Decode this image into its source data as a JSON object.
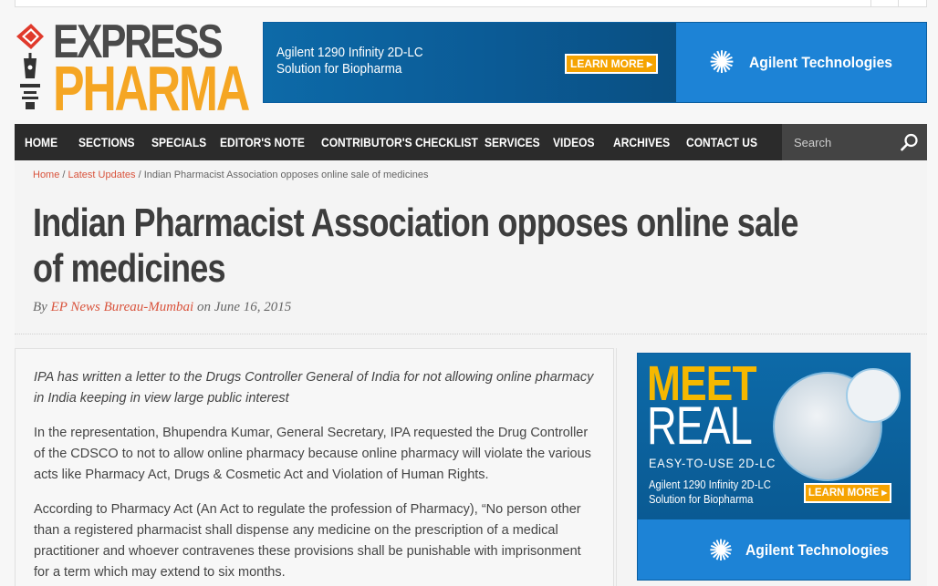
{
  "header": {
    "logo": {
      "line1": "EXPRESS",
      "line2": "PHARMA",
      "colors": {
        "line1": "#4a4a4a",
        "line2": "#f5a623",
        "mark": "#e03a2c"
      }
    }
  },
  "banner_ad": {
    "product": "Agilent 1290 Infinity 2D-LC",
    "tagline": "Solution for Biopharma",
    "button": "LEARN MORE ▸",
    "brand": "Agilent Technologies",
    "brand_icon": "agilent-spark-icon"
  },
  "nav": {
    "items": [
      {
        "label": "HOME"
      },
      {
        "label": "SECTIONS"
      },
      {
        "label": "SPECIALS"
      },
      {
        "label": "EDITOR'S NOTE"
      },
      {
        "label": "CONTRIBUTOR'S CHECKLIST"
      },
      {
        "label": "SERVICES"
      },
      {
        "label": "VIDEOS"
      },
      {
        "label": "ARCHIVES"
      },
      {
        "label": "CONTACT US"
      }
    ],
    "search": {
      "placeholder": "Search",
      "icon": "search-icon"
    }
  },
  "breadcrumb": {
    "home": "Home",
    "sep": " / ",
    "section": "Latest Updates",
    "current": "Indian Pharmacist Association opposes online sale of medicines"
  },
  "article": {
    "title": "Indian Pharmacist Association opposes online sale of medicines",
    "byline_prefix": "By ",
    "author": "EP News Bureau-Mumbai",
    "date_prefix": " on ",
    "date": "June 16, 2015",
    "paragraphs": [
      "IPA has written a letter to the Drugs Controller General of India for not allowing online pharmacy in India keeping in view large public interest",
      "In the representation, Bhupendra Kumar, General Secretary, IPA requested the Drug Controller of the CDSCO to not to allow online pharmacy because online pharmacy will violate the various acts like Pharmacy Act, Drugs & Cosmetic Act and Violation of Human Rights.",
      "According to Pharmacy Act (An Act to regulate the profession of Pharmacy), “No person other than a registered pharmacist shall dispense any medicine on the prescription of a medical practitioner and whoever contravenes these provisions shall be punishable with imprisonment for a term which may extend to six months."
    ]
  },
  "sidebar_ad": {
    "headline1": "MEET",
    "headline2": "REAL",
    "subhead": "EASY-TO-USE 2D-LC",
    "product": "Agilent 1290 Infinity 2D-LC",
    "tagline": "Solution for Biopharma",
    "button": "LEARN MORE ▸",
    "brand": "Agilent Technologies"
  },
  "colors": {
    "accent": "#d9533c",
    "nav_bg": "#2b2b2b",
    "agilent_blue": "#1d83d6",
    "ad_orange": "#f5a300"
  }
}
